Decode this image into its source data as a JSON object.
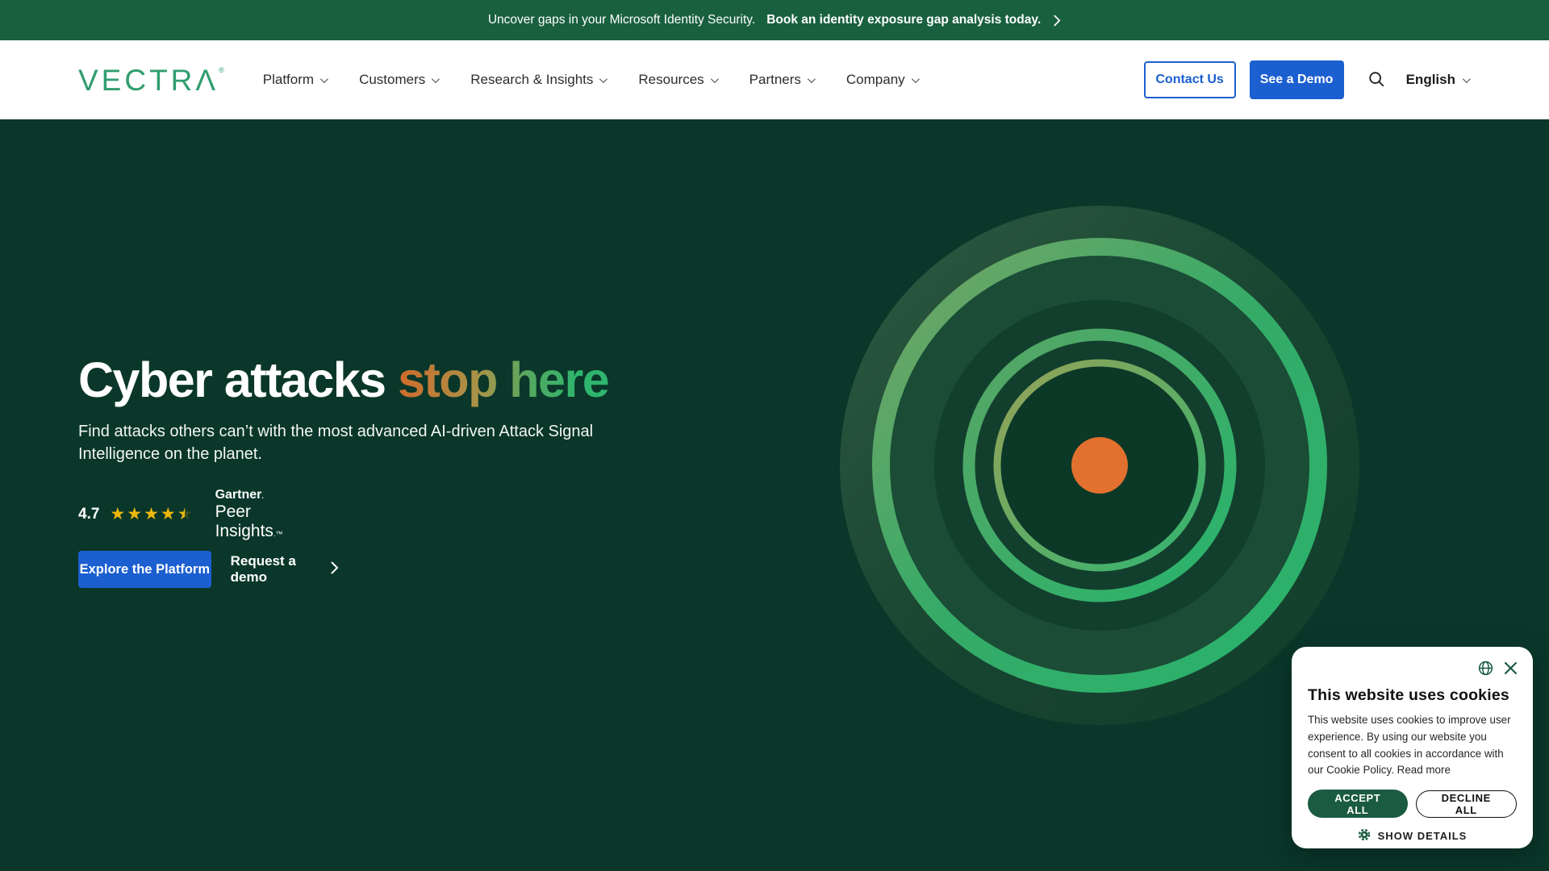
{
  "colors": {
    "banner-green": "#19603f",
    "hero-bg": "#0a372a",
    "blue": "#1b5fd0",
    "logo-green": "#2f9e6e",
    "star-gold": "#eeb80e",
    "popup-green": "#1a5b41",
    "orange": "#e2702e"
  },
  "banner": {
    "text": "Uncover gaps in your Microsoft Identity Security.",
    "cta": "Book an identity exposure gap analysis today."
  },
  "nav": {
    "logo_text": "VECTRΛ",
    "logo_mark": "®",
    "items": [
      "Platform",
      "Customers",
      "Research & Insights",
      "Resources",
      "Partners",
      "Company"
    ],
    "contact_label": "Contact Us",
    "demo_label": "See a Demo",
    "language": "English"
  },
  "hero": {
    "title_white": "Cyber attacks ",
    "title_gradient": "stop here",
    "subtitle": "Find attacks others can’t with the most advanced AI-driven Attack Signal Intelligence on the planet.",
    "rating": {
      "score": "4.7",
      "stars": "★★★★★",
      "brand_top": "Gartner",
      "brand_top_mark": ".",
      "brand_bottom": "Peer Insights",
      "brand_bottom_mark": ".™"
    },
    "primary_cta": "Explore the Platform",
    "secondary_cta": "Request a demo"
  },
  "cookie_popup": {
    "title": "This website uses cookies",
    "body": "This website uses cookies to improve user experience. By using our website you consent to all cookies in accordance with our Cookie Policy. ",
    "read_more": "Read more",
    "accept_label": "ACCEPT ALL",
    "decline_label": "DECLINE ALL",
    "details_label": "SHOW DETAILS"
  }
}
